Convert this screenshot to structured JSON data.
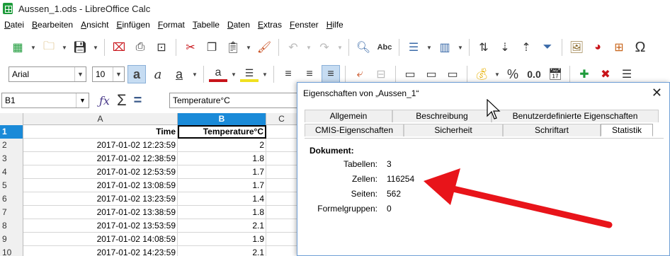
{
  "window": {
    "title": "Aussen_1.ods - LibreOffice Calc"
  },
  "menu": [
    {
      "label": "Datei"
    },
    {
      "label": "Bearbeiten"
    },
    {
      "label": "Ansicht"
    },
    {
      "label": "Einfügen"
    },
    {
      "label": "Format"
    },
    {
      "label": "Tabelle"
    },
    {
      "label": "Daten"
    },
    {
      "label": "Extras"
    },
    {
      "label": "Fenster"
    },
    {
      "label": "Hilfe"
    }
  ],
  "formatting": {
    "font_name": "Arial",
    "font_size": "10",
    "number_format_label": "0.0"
  },
  "formula_bar": {
    "cell_ref": "B1",
    "content": "Temperature°C"
  },
  "grid": {
    "columns": [
      "A",
      "B",
      "C"
    ],
    "rows": [
      {
        "num": "1",
        "a": "Time",
        "b": "Temperature°C"
      },
      {
        "num": "2",
        "a": "2017-01-02 12:23:59",
        "b": "2"
      },
      {
        "num": "3",
        "a": "2017-01-02 12:38:59",
        "b": "1.8"
      },
      {
        "num": "4",
        "a": "2017-01-02 12:53:59",
        "b": "1.7"
      },
      {
        "num": "5",
        "a": "2017-01-02 13:08:59",
        "b": "1.7"
      },
      {
        "num": "6",
        "a": "2017-01-02 13:23:59",
        "b": "1.4"
      },
      {
        "num": "7",
        "a": "2017-01-02 13:38:59",
        "b": "1.8"
      },
      {
        "num": "8",
        "a": "2017-01-02 13:53:59",
        "b": "2.1"
      },
      {
        "num": "9",
        "a": "2017-01-02 14:08:59",
        "b": "1.9"
      },
      {
        "num": "10",
        "a": "2017-01-02 14:23:59",
        "b": "2.1"
      }
    ]
  },
  "dialog": {
    "title": "Eigenschaften von „Aussen_1“",
    "tabs_row1": [
      "Allgemein",
      "Beschreibung",
      "Benutzerdefinierte Eigenschaften"
    ],
    "tabs_row2": [
      "CMIS-Eigenschaften",
      "Sicherheit",
      "Schriftart",
      "Statistik"
    ],
    "section": "Dokument:",
    "stats": [
      {
        "label": "Tabellen:",
        "value": "3"
      },
      {
        "label": "Zellen:",
        "value": "116254"
      },
      {
        "label": "Seiten:",
        "value": "562"
      },
      {
        "label": "Formelgruppen:",
        "value": "0"
      }
    ]
  },
  "colors": {
    "selection": "#1a8ad8",
    "arrow": "#e8141a",
    "app_green": "#1e9b3b"
  }
}
